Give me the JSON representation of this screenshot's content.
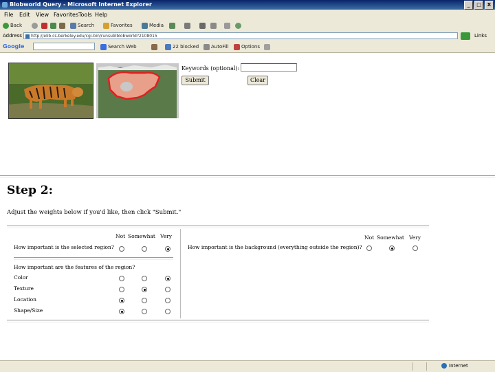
{
  "window": {
    "title": "Blobworld Query - Microsoft Internet Explorer",
    "buttons": [
      "_",
      "□",
      "X"
    ]
  },
  "menu": [
    "File",
    "Edit",
    "View",
    "Favorites",
    "Tools",
    "Help"
  ],
  "toolbar": {
    "back": "Back",
    "search": "Search",
    "favorites": "Favorites",
    "media": "Media"
  },
  "address": {
    "label": "Address",
    "url": "http://elib.cs.berkeley.edu/cgi-bin/runsublblobworld?2108015",
    "links": "Links"
  },
  "google_bar": {
    "logo": "Google",
    "search_web": "Search Web",
    "blocked": "22 blocked",
    "autofill": "AutoFill",
    "options": "Options"
  },
  "query": {
    "keywords_label": "Keywords (optional):",
    "keywords_value": "",
    "submit": "Submit",
    "clear": "Clear"
  },
  "step": {
    "heading": "Step 2:",
    "instructions": "Adjust the weights below if you'd like, then click \"Submit.\""
  },
  "weights": {
    "columns": [
      "Not",
      "Somewhat",
      "Very"
    ],
    "region_question": "How important is the selected region?",
    "region_selected": 2,
    "features_question": "How important are the features of the region?",
    "features": [
      {
        "label": "Color",
        "selected": 2
      },
      {
        "label": "Texture",
        "selected": 1
      },
      {
        "label": "Location",
        "selected": 0
      },
      {
        "label": "Shape/Size",
        "selected": 0
      }
    ],
    "background_question": "How important is the background (everything outside the region)?",
    "background_selected": 1
  },
  "status": {
    "zone": "Internet"
  },
  "colors": {
    "titlebar": "#0a246a",
    "chrome": "#ece9d8",
    "segment_fill": "#e8a08a",
    "segment_outline": "#e02020",
    "segment_bg": "#5a7a4a"
  }
}
